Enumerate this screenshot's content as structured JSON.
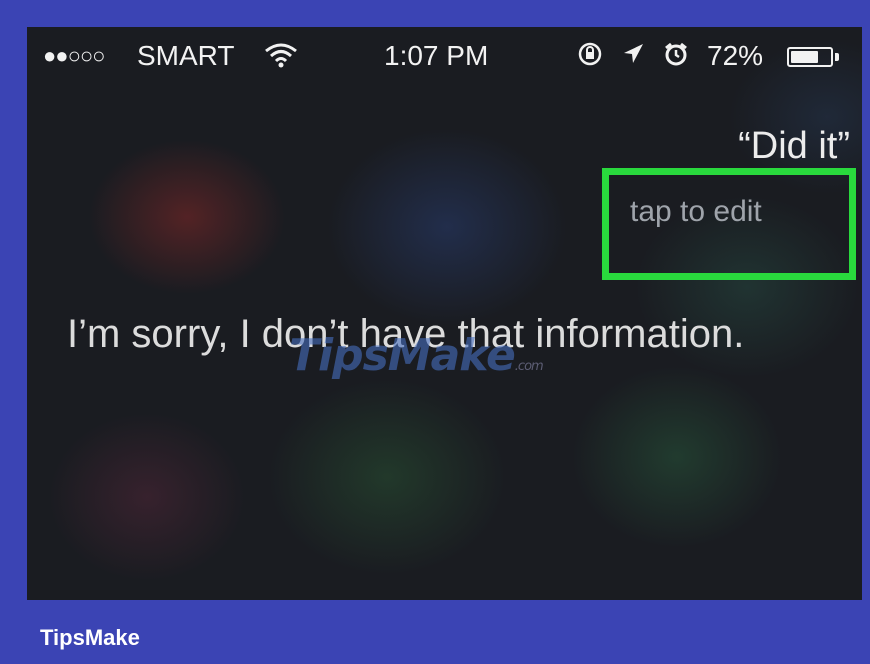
{
  "status_bar": {
    "signal": "●●○○○",
    "carrier": "SMART",
    "wifi_icon": "wifi-icon",
    "time": "1:07 PM",
    "icons": [
      "rotation-lock-icon",
      "location-arrow-icon",
      "alarm-icon"
    ],
    "battery_percent": "72%",
    "battery_level": 0.72
  },
  "siri": {
    "heard_query": "“Did it”",
    "tap_to_edit": "tap to edit",
    "response": "I’m sorry, I don’t have that information."
  },
  "highlight_color": "#29d93d",
  "watermark": {
    "text": "TipsMake",
    "suffix": ".com"
  },
  "brand": "TipsMake",
  "frame_color": "#3b44b4"
}
